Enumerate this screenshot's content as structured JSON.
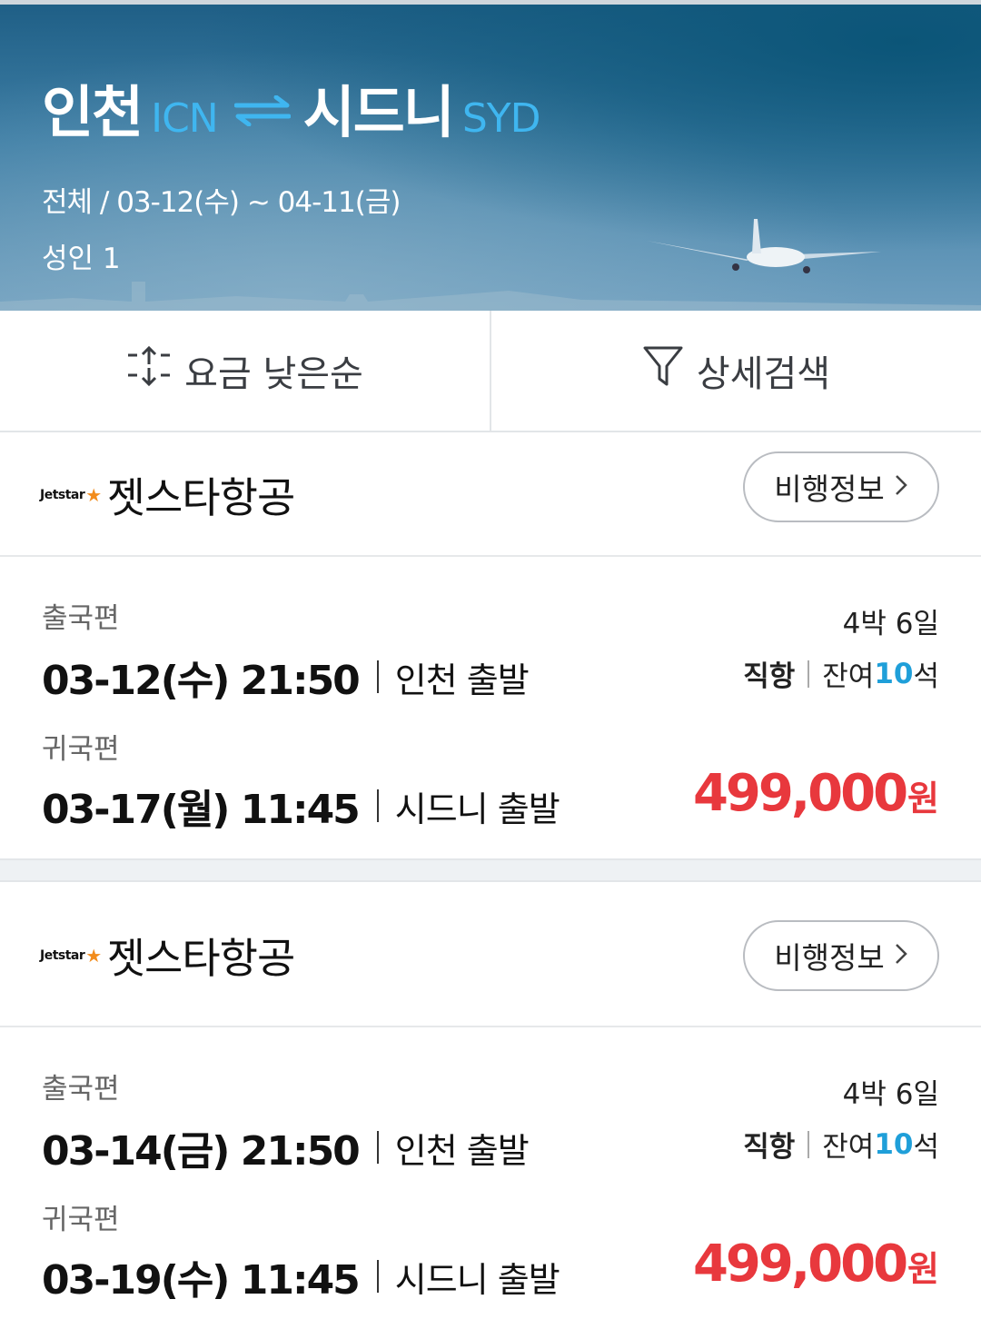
{
  "header": {
    "origin_city": "인천",
    "origin_code": "ICN",
    "dest_city": "시드니",
    "dest_code": "SYD",
    "dates": "전체 / 03-12(수)  ~  04-11(금)",
    "passengers": "성인 1",
    "swap_icon": "round-trip-arrows-icon"
  },
  "toolbar": {
    "sort_label": "요금 낮은순",
    "sort_icon": "sort-arrows-icon",
    "filter_label": "상세검색",
    "filter_icon": "funnel-icon"
  },
  "results": [
    {
      "airline_logo": "Jetstar",
      "airline": "젯스타항공",
      "info_button": "비행정보",
      "outbound_label": "출국편",
      "outbound_datetime": "03-12(수) 21:50",
      "outbound_depart": "인천 출발",
      "return_label": "귀국편",
      "return_datetime": "03-17(월) 11:45",
      "return_depart": "시드니 출발",
      "duration": "4박 6일",
      "direct": "직항",
      "seats_prefix": "잔여",
      "seats_count": "10",
      "seats_suffix": "석",
      "price": "499,000",
      "currency": "원"
    },
    {
      "airline_logo": "Jetstar",
      "airline": "젯스타항공",
      "info_button": "비행정보",
      "outbound_label": "출국편",
      "outbound_datetime": "03-14(금) 21:50",
      "outbound_depart": "인천 출발",
      "return_label": "귀국편",
      "return_datetime": "03-19(수) 11:45",
      "return_depart": "시드니 출발",
      "duration": "4박 6일",
      "direct": "직항",
      "seats_prefix": "잔여",
      "seats_count": "10",
      "seats_suffix": "석",
      "price": "499,000",
      "currency": "원"
    }
  ],
  "colors": {
    "price": "#e8383d",
    "seats": "#1f9fd9",
    "code": "#3fb6f0"
  }
}
